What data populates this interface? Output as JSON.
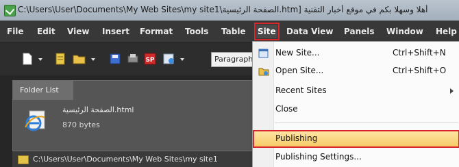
{
  "window": {
    "title": "C:\\Users\\User\\Documents\\My Web Sites\\my site1\\الصفحة الرئيسية.htm] أهلا وسهلا بكم في موقع أخبار التقنية"
  },
  "menubar": {
    "items": [
      "File",
      "Edit",
      "View",
      "Insert",
      "Format",
      "Tools",
      "Table",
      "Site",
      "Data View",
      "Panels",
      "Window",
      "Help"
    ],
    "active": "Site"
  },
  "toolbar": {
    "paragraph_select": "Paragraph"
  },
  "folder_list": {
    "tab_label": "Folder List",
    "file": {
      "name": "الصفحة الرئيسية.html",
      "size": "870 bytes",
      "icon": "ie-page-icon"
    },
    "path": "C:\\Users\\User\\Documents\\My Web Sites\\my site1"
  },
  "site_menu": {
    "items": [
      {
        "label": "New Site...",
        "shortcut": "Ctrl+Shift+N",
        "icon": "new-site-icon"
      },
      {
        "label": "Open Site...",
        "shortcut": "Ctrl+Shift+O",
        "icon": "open-site-icon"
      },
      {
        "label": "Recent Sites",
        "shortcut": "",
        "submenu": true
      },
      {
        "label": "Close",
        "shortcut": ""
      },
      {
        "label": "Publishing",
        "shortcut": "",
        "highlighted": true
      },
      {
        "label": "Publishing Settings...",
        "shortcut": ""
      }
    ]
  },
  "colors": {
    "highlight_outline": "#d8262a",
    "menubar_bg": "#383838",
    "highlight_bg": "#f6c962"
  }
}
